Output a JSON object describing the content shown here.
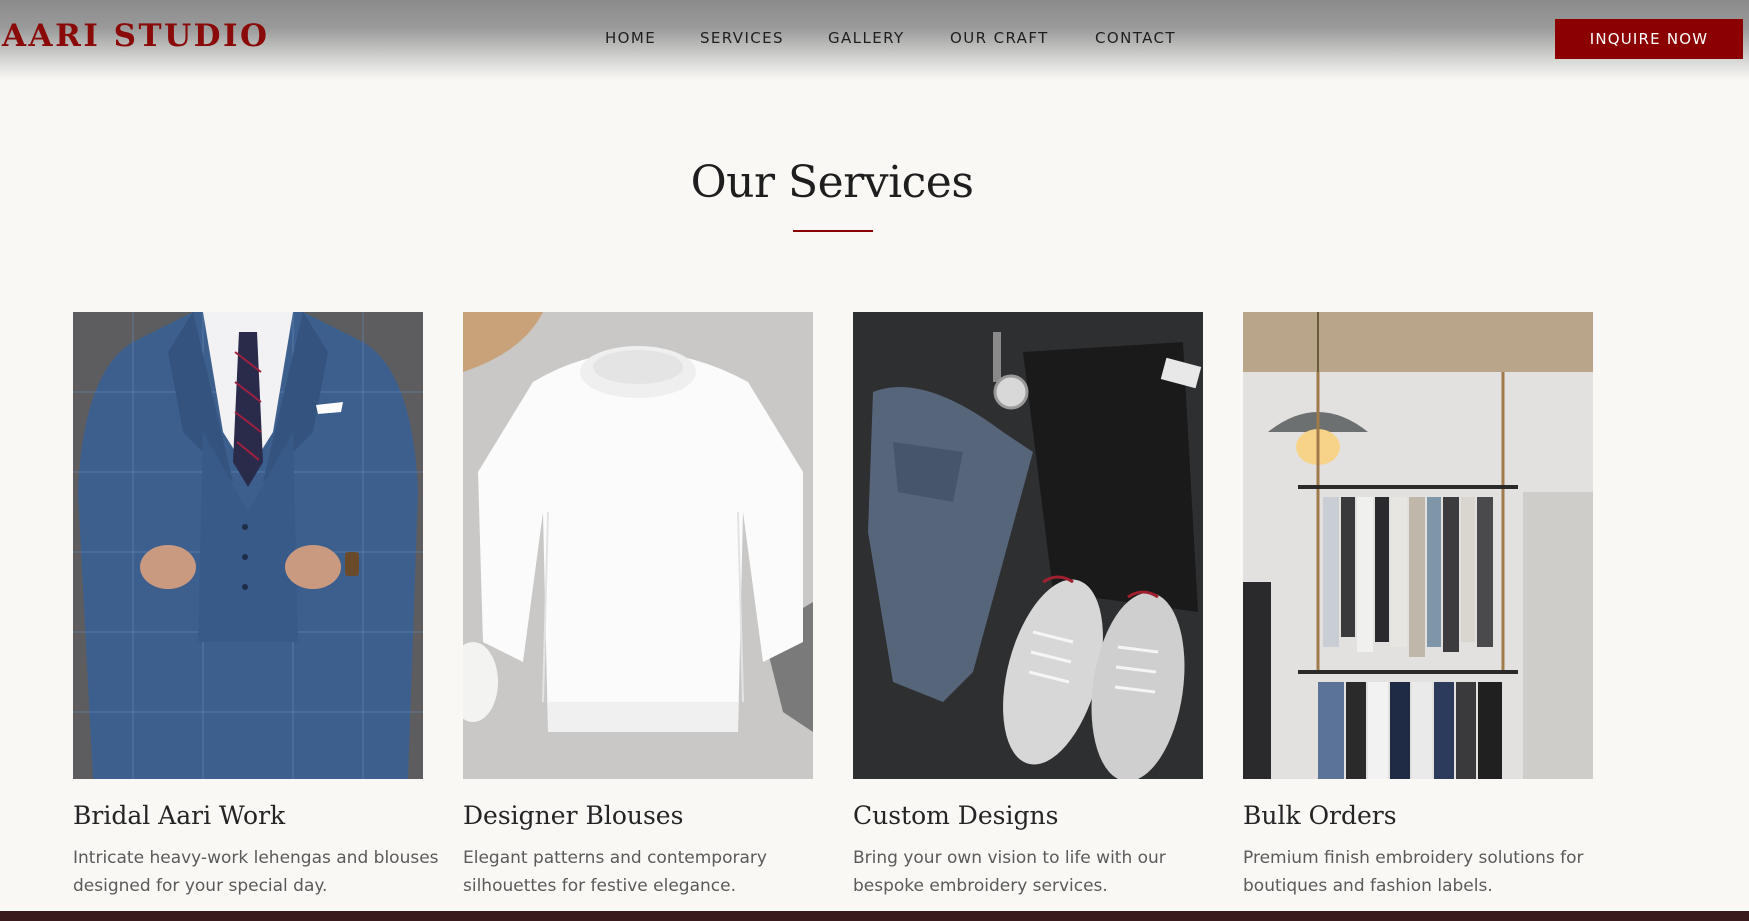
{
  "header": {
    "logo": "AARI STUDIO",
    "nav": [
      {
        "label": "HOME"
      },
      {
        "label": "SERVICES"
      },
      {
        "label": "GALLERY"
      },
      {
        "label": "OUR CRAFT"
      },
      {
        "label": "CONTACT"
      }
    ],
    "cta_label": "INQUIRE NOW"
  },
  "section": {
    "title": "Our Services"
  },
  "cards": [
    {
      "title": "Bridal Aari Work",
      "description": "Intricate heavy-work lehengas and blouses designed for your special day."
    },
    {
      "title": "Designer Blouses",
      "description": "Elegant patterns and contemporary silhouettes for festive elegance."
    },
    {
      "title": "Custom Designs",
      "description": "Bring your own vision to life with our bespoke embroidery services."
    },
    {
      "title": "Bulk Orders",
      "description": "Premium finish embroidery solutions for boutiques and fashion labels."
    }
  ],
  "colors": {
    "accent": "#8b0000",
    "background": "#f9f8f5"
  }
}
